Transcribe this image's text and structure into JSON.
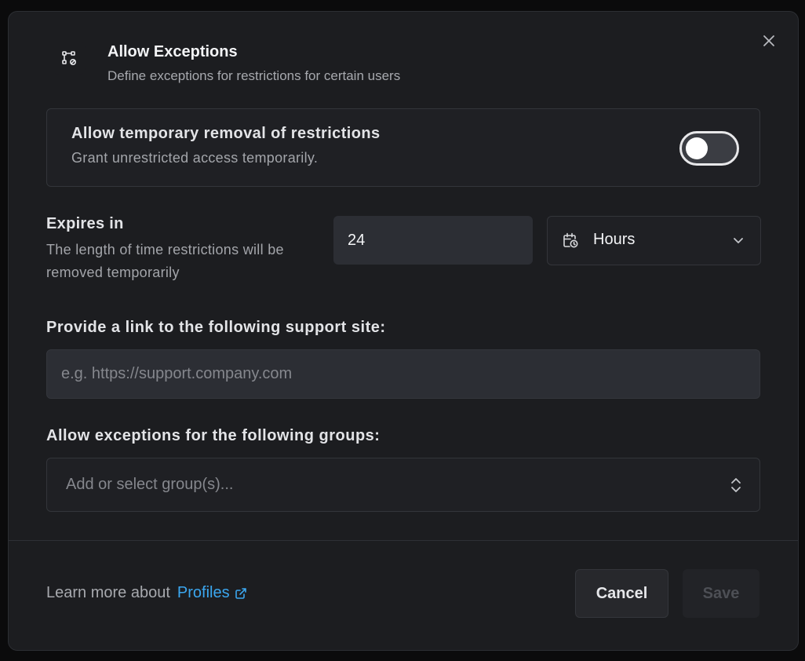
{
  "dialog": {
    "title": "Allow Exceptions",
    "subtitle": "Define exceptions for restrictions for certain users",
    "header_icon": "workflow-exception-icon",
    "close_icon": "close-icon"
  },
  "temporary_removal": {
    "title": "Allow temporary removal of restrictions",
    "description": "Grant unrestricted access temporarily.",
    "enabled": false
  },
  "expires": {
    "label": "Expires in",
    "description": "The length of time restrictions will be removed temporarily",
    "value": "24",
    "unit": "Hours",
    "unit_icon": "calendar-clock-icon"
  },
  "support_link": {
    "label": "Provide a link to the following support site:",
    "value": "",
    "placeholder": "e.g. https://support.company.com"
  },
  "groups": {
    "label": "Allow exceptions for the following groups:",
    "placeholder": "Add or select group(s)..."
  },
  "footer": {
    "learn_more_text": "Learn more about",
    "learn_more_link": "Profiles",
    "cancel_label": "Cancel",
    "save_label": "Save"
  },
  "colors": {
    "background": "#1c1d20",
    "accent_link": "#3ba7f0",
    "input_fill": "#2c2e34"
  }
}
